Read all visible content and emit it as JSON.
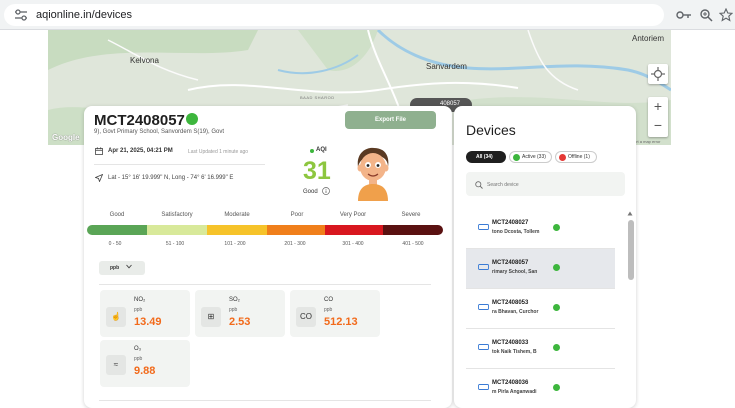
{
  "browser": {
    "url": "aqionline.in/devices"
  },
  "map": {
    "places": [
      "Antoriem",
      "Kelvona",
      "Sanvardem",
      "BAAD SHAROD"
    ],
    "attribution": "ort a map error",
    "logo_text": "Google",
    "marker_label": "408057",
    "zoom_in": "+",
    "zoom_out": "−"
  },
  "device": {
    "id": "MCT2408057",
    "address": "9), Govt Primary School, Sanvordem          S(19), Govt",
    "datetime": "Apr 21, 2025, 04:21 PM",
    "last_updated": "Last Updated 1 minute ago",
    "coords": "Lat - 15° 16' 19.999\" N, Long - 74° 6' 16.999\" E",
    "export_label": "Export File",
    "aqi_label": "AQI",
    "aqi_value": "31",
    "aqi_status": "Good",
    "status_color": "#3db63d"
  },
  "aqi_scale": {
    "categories": [
      "Good",
      "Satisfactory",
      "Moderate",
      "Poor",
      "Very Poor",
      "Severe"
    ],
    "ranges": [
      "0 - 50",
      "51 - 100",
      "101 - 200",
      "201 - 300",
      "301 - 400",
      "401 - 500"
    ],
    "colors": [
      "#5aa556",
      "#d8e99a",
      "#f6c32a",
      "#f07f1b",
      "#d8171f",
      "#5a1111"
    ]
  },
  "unit": {
    "selected": "ppb"
  },
  "pollutants": [
    {
      "name": "NO₂",
      "unit": "ppb",
      "value": "13.49",
      "icon": "hand-icon",
      "glyph": "☝"
    },
    {
      "name": "SO₂",
      "unit": "ppb",
      "value": "2.53",
      "icon": "factory-icon",
      "glyph": "⊞"
    },
    {
      "name": "CO",
      "unit": "ppb",
      "value": "512.13",
      "icon": "co-icon",
      "glyph": "CO"
    },
    {
      "name": "O₃",
      "unit": "ppb",
      "value": "9.88",
      "icon": "wave-icon",
      "glyph": "≈"
    }
  ],
  "devices_panel": {
    "title": "Devices",
    "filters": [
      {
        "label": "All (34)",
        "active": true
      },
      {
        "label": "Active (33)",
        "dot": "#3db63d"
      },
      {
        "label": "Offline (1)",
        "dot": "#e53935"
      }
    ],
    "search_placeholder": "Search device",
    "items": [
      {
        "id": "MCT2408027",
        "sub": "tono Dcosta, Tollem",
        "selected": false
      },
      {
        "id": "MCT2408057",
        "sub": "rimary School, San",
        "selected": true
      },
      {
        "id": "MCT2408053",
        "sub": "ra Bhavan, Curchor",
        "selected": false
      },
      {
        "id": "MCT2408033",
        "sub": "tok Naik Tishem, B",
        "selected": false
      },
      {
        "id": "MCT2408036",
        "sub": "m Pirla Anganwadi",
        "selected": false
      }
    ]
  }
}
